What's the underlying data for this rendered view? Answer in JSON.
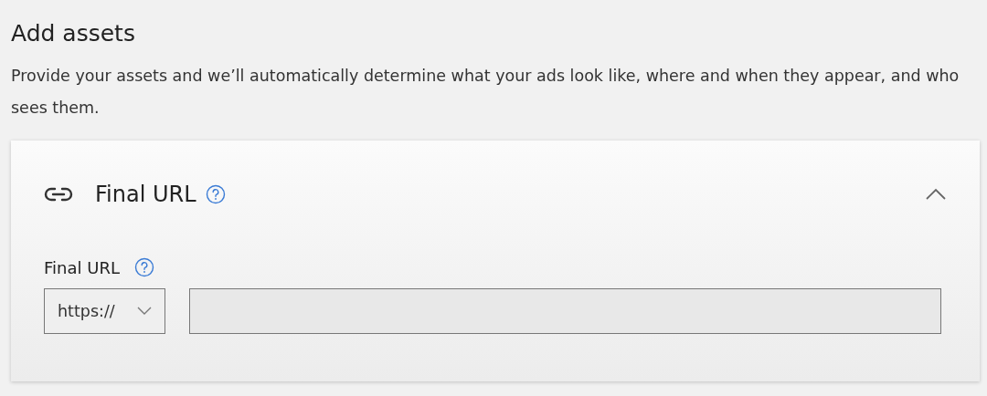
{
  "heading": "Add assets",
  "description": "Provide your assets and we’ll automatically determine what your ads look like, where and when they appear, and who sees them.",
  "section": {
    "title": "Final URL",
    "expanded": true,
    "field": {
      "label": "Final URL",
      "protocol": "https://"
    }
  }
}
